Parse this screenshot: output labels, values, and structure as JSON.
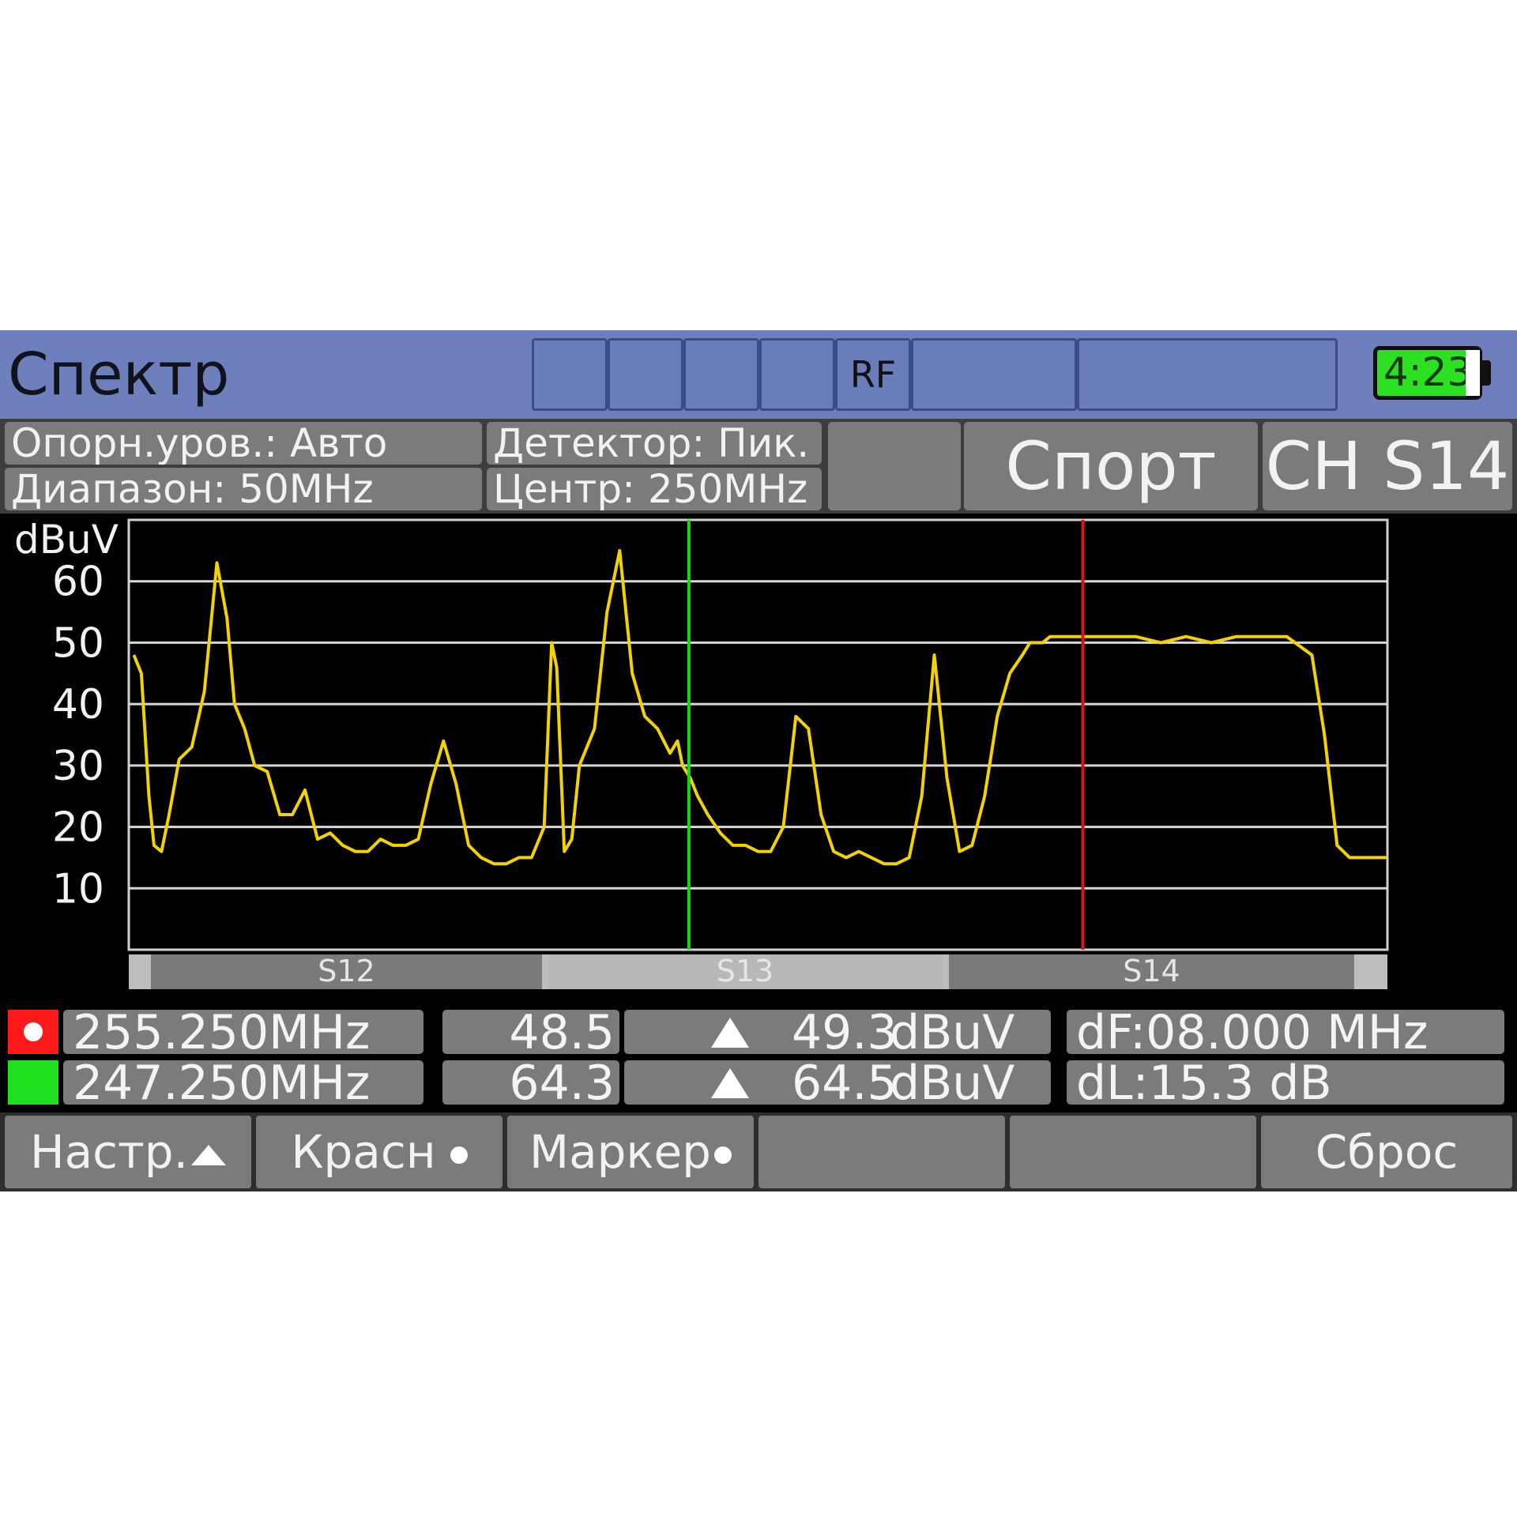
{
  "header": {
    "title": "Спектр",
    "rf_label": "RF",
    "battery_time": "4:23"
  },
  "info": {
    "ref_level": "Опорн.уров.: Авто",
    "span": "Диапазон: 50MHz",
    "detector": "Детектор: Пик.",
    "center": "Центр: 250MHz",
    "program": "Спорт",
    "channel": "CH S14"
  },
  "markers": [
    {
      "name": "red",
      "color": "#ff1a1a",
      "freq": "255.250MHz",
      "level": "48.5",
      "peak": "49.3",
      "unit": "dBuV",
      "delta": "dF:08.000 MHz"
    },
    {
      "name": "green",
      "color": "#1fe01f",
      "freq": "247.250MHz",
      "level": "64.3",
      "peak": "64.5",
      "unit": "dBuV",
      "delta": "dL:15.3 dB"
    }
  ],
  "softkeys": [
    "Настр.",
    "Красн",
    "Маркер",
    "",
    "",
    "Сброс"
  ],
  "chart_data": {
    "type": "line",
    "ylabel": "dBuV",
    "y_ticks": [
      60,
      50,
      40,
      30,
      20,
      10
    ],
    "ylim": [
      0,
      70
    ],
    "xlim": [
      225,
      275
    ],
    "grid": true,
    "channels": [
      "S12",
      "S13",
      "S14"
    ],
    "marker_lines": [
      {
        "name": "green-marker",
        "x": 247.25,
        "color": "#16d816"
      },
      {
        "name": "red-marker",
        "x": 262.9,
        "color": "#d81414"
      }
    ],
    "series": [
      {
        "color": "#f2d200",
        "x": [
          225.2,
          225.5,
          225.8,
          226.0,
          226.3,
          226.6,
          227.0,
          227.5,
          228.0,
          228.5,
          228.9,
          229.2,
          229.6,
          230.0,
          230.5,
          231.0,
          231.5,
          232.0,
          232.5,
          233.0,
          233.5,
          234.0,
          234.5,
          235.0,
          235.5,
          236.0,
          236.5,
          237.0,
          237.5,
          238.0,
          238.5,
          239.0,
          239.5,
          240.0,
          240.5,
          241.0,
          241.5,
          241.8,
          242.0,
          242.3,
          242.6,
          242.9,
          243.2,
          243.5,
          244.0,
          244.5,
          245.0,
          245.5,
          246.0,
          246.5,
          246.8,
          247.0,
          247.3,
          247.6,
          248.0,
          248.5,
          249.0,
          249.5,
          250.0,
          250.5,
          251.0,
          251.5,
          252.0,
          252.5,
          253.0,
          253.5,
          254.0,
          254.5,
          255.0,
          255.5,
          256.0,
          256.5,
          257.0,
          257.5,
          258.0,
          258.5,
          259.0,
          259.5,
          260.0,
          260.5,
          260.8,
          261.0,
          261.3,
          261.6,
          262.0,
          262.5,
          263.0,
          264.0,
          265.0,
          266.0,
          267.0,
          268.0,
          269.0,
          270.0,
          271.0,
          272.0,
          272.5,
          273.0,
          273.5,
          274.0,
          274.5,
          275.0
        ],
        "y": [
          48,
          45,
          25,
          17,
          16,
          22,
          31,
          33,
          42,
          63,
          54,
          40,
          36,
          30,
          29,
          22,
          22,
          26,
          18,
          19,
          17,
          16,
          16,
          18,
          17,
          17,
          18,
          27,
          34,
          27,
          17,
          15,
          14,
          14,
          15,
          15,
          20,
          50,
          46,
          16,
          18,
          30,
          33,
          36,
          55,
          65,
          45,
          38,
          36,
          32,
          34,
          30,
          28,
          25,
          22,
          19,
          17,
          17,
          16,
          16,
          20,
          38,
          36,
          22,
          16,
          15,
          16,
          15,
          14,
          14,
          15,
          25,
          48,
          28,
          16,
          17,
          25,
          38,
          45,
          48,
          50,
          50,
          50,
          51,
          51,
          51,
          51,
          51,
          51,
          50,
          51,
          50,
          51,
          51,
          51,
          48,
          35,
          17,
          15,
          15,
          15,
          15
        ]
      }
    ]
  }
}
